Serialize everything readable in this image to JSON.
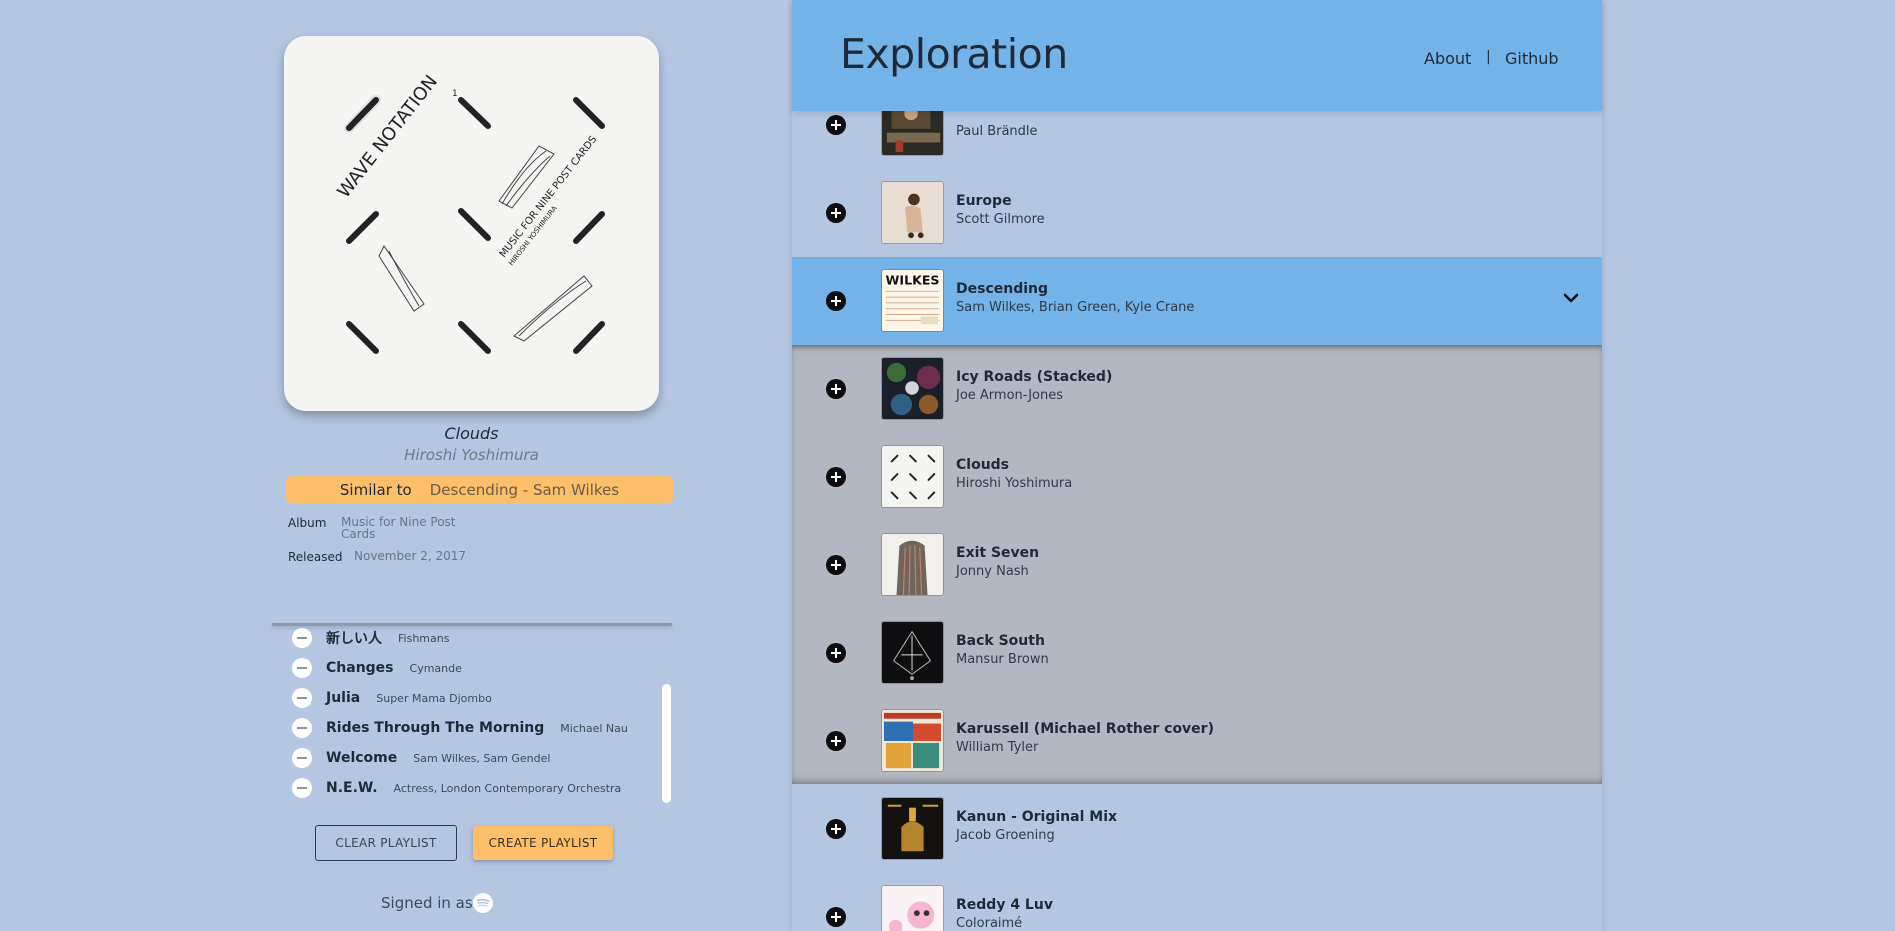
{
  "app": {
    "title": "Exploration",
    "nav": {
      "about": "About",
      "separator": "|",
      "github": "Github"
    }
  },
  "now_playing": {
    "cover_lettering": [
      "WAVE NOTATION",
      "1",
      "MUSIC FOR NINE POST CARDS",
      "HIROSHI YOSHIMURA"
    ],
    "title": "Clouds",
    "artist": "Hiroshi Yoshimura",
    "similar_label": "Similar to",
    "similar_value": "Descending - Sam Wilkes",
    "album_label": "Album",
    "album_line1": "Music for Nine Post",
    "album_line2": "Cards",
    "released_label": "Released",
    "released_value": "November 2, 2017"
  },
  "playlist": [
    {
      "track": "新しい人",
      "artist": "Fishmans"
    },
    {
      "track": "Changes",
      "artist": "Cymande"
    },
    {
      "track": "Julia",
      "artist": "Super Mama Djombo"
    },
    {
      "track": "Rides Through The Morning",
      "artist": "Michael Nau"
    },
    {
      "track": "Welcome",
      "artist": "Sam Wilkes, Sam Gendel"
    },
    {
      "track": "N.E.W.",
      "artist": "Actress, London Contemporary Orchestra"
    }
  ],
  "actions": {
    "clear": "CLEAR PLAYLIST",
    "create": "CREATE PLAYLIST",
    "signed_in": "Signed in as"
  },
  "feed": [
    {
      "title": "",
      "artist": "Paul Brändle",
      "thumb_text": "",
      "state": "normal"
    },
    {
      "title": "Europe",
      "artist": "Scott Gilmore",
      "thumb_text": "",
      "state": "normal"
    },
    {
      "title": "Descending",
      "artist": "Sam Wilkes, Brian Green, Kyle Crane",
      "thumb_text": "WILKES",
      "state": "active"
    },
    {
      "title": "Icy Roads (Stacked)",
      "artist": "Joe Armon-Jones",
      "thumb_text": "",
      "state": "grey"
    },
    {
      "title": "Clouds",
      "artist": "Hiroshi Yoshimura",
      "thumb_text": "",
      "state": "grey"
    },
    {
      "title": "Exit Seven",
      "artist": "Jonny Nash",
      "thumb_text": "",
      "state": "grey"
    },
    {
      "title": "Back South",
      "artist": "Mansur Brown",
      "thumb_text": "",
      "state": "grey"
    },
    {
      "title": "Karussell (Michael Rother cover)",
      "artist": "William Tyler",
      "thumb_text": "",
      "state": "grey"
    },
    {
      "title": "Kanun - Original Mix",
      "artist": "Jacob Groening",
      "thumb_text": "",
      "state": "normal"
    },
    {
      "title": "Reddy 4 Luv",
      "artist": "Coloraimé",
      "thumb_text": "",
      "state": "normal"
    }
  ],
  "icons": {
    "add": "plus-circle-icon",
    "remove": "minus-circle-icon",
    "expand": "chevron-down-icon",
    "account": "spotify-icon"
  },
  "colors": {
    "background": "#b5c6e3",
    "header": "#74b3e8",
    "accent": "#fdbf6a",
    "active_row": "#74b3e8",
    "grey_band": "#b3b7c2"
  }
}
